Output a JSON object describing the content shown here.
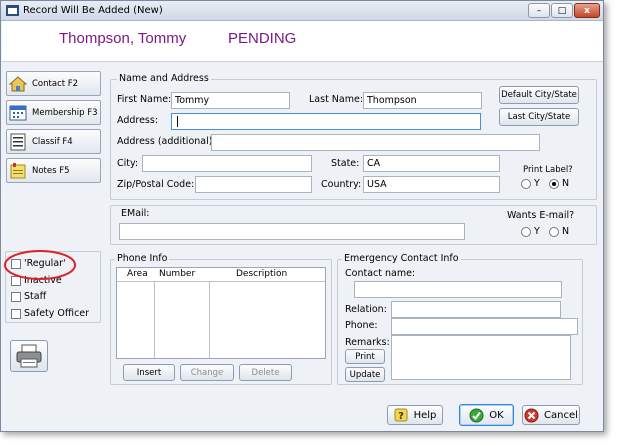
{
  "window": {
    "title": "Record Will Be Added  (New)",
    "min_label": "–",
    "max_label": "□",
    "close_label": "x"
  },
  "header": {
    "name": "Thompson, Tommy",
    "status": "PENDING",
    "name_color": "#7a1a86"
  },
  "sidebar": {
    "buttons": [
      {
        "label": "Contact  F2",
        "icon": "house-icon"
      },
      {
        "label": "Membership F3",
        "icon": "calendar-icon"
      },
      {
        "label": "Classif   F4",
        "icon": "list-icon"
      },
      {
        "label": "Notes      F5",
        "icon": "notes-icon"
      }
    ],
    "checkboxes": [
      {
        "label": "'Regular'",
        "checked": false
      },
      {
        "label": "Inactive",
        "checked": false
      },
      {
        "label": "Staff",
        "checked": false
      },
      {
        "label": "Safety Officer",
        "checked": false
      }
    ]
  },
  "name_address": {
    "group_label": "Name and Address",
    "first_name_label": "First Name:",
    "first_name_value": "Tommy",
    "last_name_label": "Last Name:",
    "last_name_value": "Thompson",
    "default_city_state_label": "Default City/State",
    "last_city_state_label": "Last City/State",
    "address_label": "Address:",
    "address_value": "",
    "address_additional_label": "Address (additional):",
    "address_additional_value": "",
    "city_label": "City:",
    "city_value": "",
    "state_label": "State:",
    "state_value": "CA",
    "zip_label": "Zip/Postal Code:",
    "zip_value": "",
    "country_label": "Country:",
    "country_value": "USA",
    "print_label_title": "Print Label?",
    "print_label_y": "Y",
    "print_label_n": "N",
    "print_label_selected": "N"
  },
  "email": {
    "label": "EMail:",
    "value": "",
    "wants_label": "Wants  E-mail?",
    "y": "Y",
    "n": "N",
    "selected": ""
  },
  "phone_info": {
    "group_label": "Phone Info",
    "columns": [
      "Area",
      "Number",
      "Description"
    ],
    "rows": [],
    "insert_label": "Insert",
    "change_label": "Change",
    "delete_label": "Delete"
  },
  "emergency": {
    "group_label": "Emergency Contact Info",
    "contact_name_label": "Contact name:",
    "contact_name_value": "",
    "relation_label": "Relation:",
    "relation_value": "",
    "phone_label": "Phone:",
    "phone_value": "",
    "remarks_label": "Remarks:",
    "remarks_value": "",
    "print_label": "Print",
    "update_label": "Update"
  },
  "footer": {
    "help_label": "Help",
    "ok_label": "OK",
    "cancel_label": "Cancel"
  },
  "annotation": {
    "highlight_color": "#e0202a"
  }
}
